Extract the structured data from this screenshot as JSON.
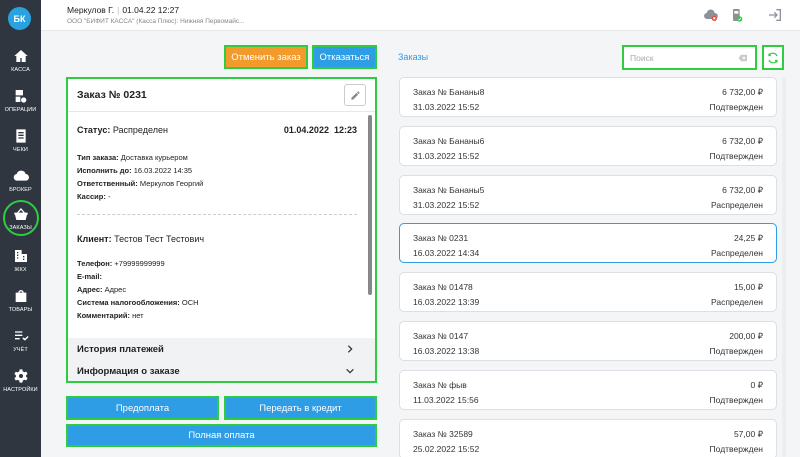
{
  "sidebar": {
    "avatar": "БК",
    "items": [
      {
        "label": "КАССА",
        "icon": "home-icon"
      },
      {
        "label": "ОПЕРАЦИИ",
        "icon": "operations-icon"
      },
      {
        "label": "ЧЕКИ",
        "icon": "receipt-icon"
      },
      {
        "label": "БРОКЕР",
        "icon": "cloud-icon"
      },
      {
        "label": "ЗАКАЗЫ",
        "icon": "basket-icon",
        "active": true
      },
      {
        "label": "ЖКХ",
        "icon": "building-icon"
      },
      {
        "label": "ТОВАРЫ",
        "icon": "bag-icon"
      },
      {
        "label": "УЧЁТ",
        "icon": "checklist-icon"
      },
      {
        "label": "НАСТРОЙКИ",
        "icon": "gear-icon"
      }
    ]
  },
  "header": {
    "user": "Меркулов Г.",
    "datetime": "01.04.22 12:27",
    "org": "ООО \"БИФИТ КАССА\" (Касса Плюс): Нижняя Первомайс..."
  },
  "actions": {
    "cancel_order": "Отменить заказ",
    "refuse": "Отказаться",
    "prepay": "Предоплата",
    "credit": "Передать в кредит",
    "full_pay": "Полная оплата"
  },
  "order": {
    "title": "Заказ № 0231",
    "status_label": "Статус:",
    "status_value": "Распределен",
    "status_date": "01.04.2022",
    "status_time": "12:23",
    "type_label": "Тип заказа:",
    "type_value": "Доставка курьером",
    "due_label": "Исполнить до:",
    "due_value": "16.03.2022 14:35",
    "resp_label": "Ответственный:",
    "resp_value": "Меркулов Георгий",
    "cashier_label": "Кассир:",
    "cashier_value": "-",
    "client_label": "Клиент:",
    "client_value": "Тестов Тест Тестович",
    "phone_label": "Телефон:",
    "phone_value": "+79999999999",
    "email_label": "E-mail:",
    "email_value": "",
    "address_label": "Адрес:",
    "address_value": "Адрес",
    "tax_label": "Система налогообложения:",
    "tax_value": "ОСН",
    "comment_label": "Комментарий:",
    "comment_value": "нет",
    "payments_history": "История платежей",
    "order_info": "Информация о заказе"
  },
  "orders_panel": {
    "tab": "Заказы",
    "search_placeholder": "Поиск",
    "items": [
      {
        "name": "Заказ № Бананы8",
        "date": "31.03.2022 15:52",
        "sum": "6 732,00 ₽",
        "status": "Подтвержден"
      },
      {
        "name": "Заказ № Бананы6",
        "date": "31.03.2022 15:52",
        "sum": "6 732,00 ₽",
        "status": "Подтвержден"
      },
      {
        "name": "Заказ № Бананы5",
        "date": "31.03.2022 15:52",
        "sum": "6 732,00 ₽",
        "status": "Распределен"
      },
      {
        "name": "Заказ № 0231",
        "date": "16.03.2022 14:34",
        "sum": "24,25 ₽",
        "status": "Распределен",
        "selected": true
      },
      {
        "name": "Заказ № 01478",
        "date": "16.03.2022 13:39",
        "sum": "15,00 ₽",
        "status": "Распределен"
      },
      {
        "name": "Заказ № 0147",
        "date": "16.03.2022 13:38",
        "sum": "200,00 ₽",
        "status": "Подтвержден"
      },
      {
        "name": "Заказ № фыв",
        "date": "11.03.2022 15:56",
        "sum": "0 ₽",
        "status": "Подтвержден"
      },
      {
        "name": "Заказ № 32589",
        "date": "25.02.2022 15:52",
        "sum": "57,00 ₽",
        "status": "Подтвержден"
      }
    ]
  },
  "colors": {
    "sidebar": "#2f3640",
    "accent_blue": "#2e9de6",
    "accent_orange": "#f39a2c",
    "highlight_green": "#2ecc40"
  }
}
